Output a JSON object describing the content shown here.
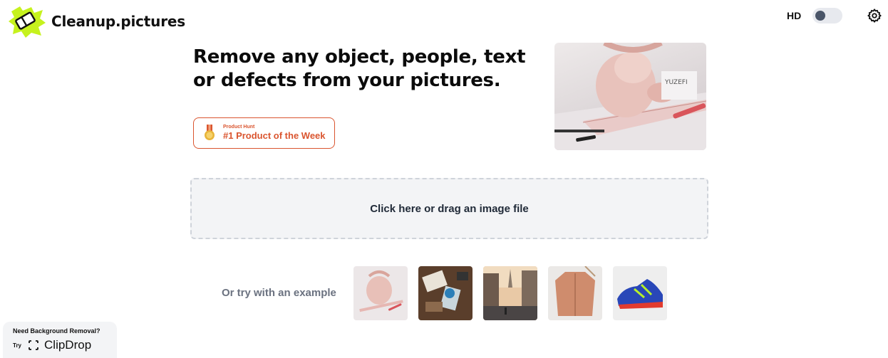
{
  "header": {
    "logo_text": "Cleanup.pictures",
    "hd_label": "HD",
    "hd_enabled": false,
    "logo_color": "#c6f21e",
    "icons": {
      "logo": "eraser-icon",
      "settings": "gear-icon"
    }
  },
  "hero": {
    "title": "Remove any object, people, text or defects from your pictures.",
    "badge_small": "Product Hunt",
    "badge_big": "#1 Product of the Week",
    "badge_color": "#da552f"
  },
  "dropzone": {
    "label": "Click here or drag an image file"
  },
  "examples": {
    "label": "Or try with an example",
    "items": [
      "handbag",
      "desk-items",
      "city-street",
      "jacket",
      "sneaker"
    ]
  },
  "clipdrop": {
    "need_text": "Need Background Removal?",
    "try_text": "Try",
    "brand": "ClipDrop"
  }
}
